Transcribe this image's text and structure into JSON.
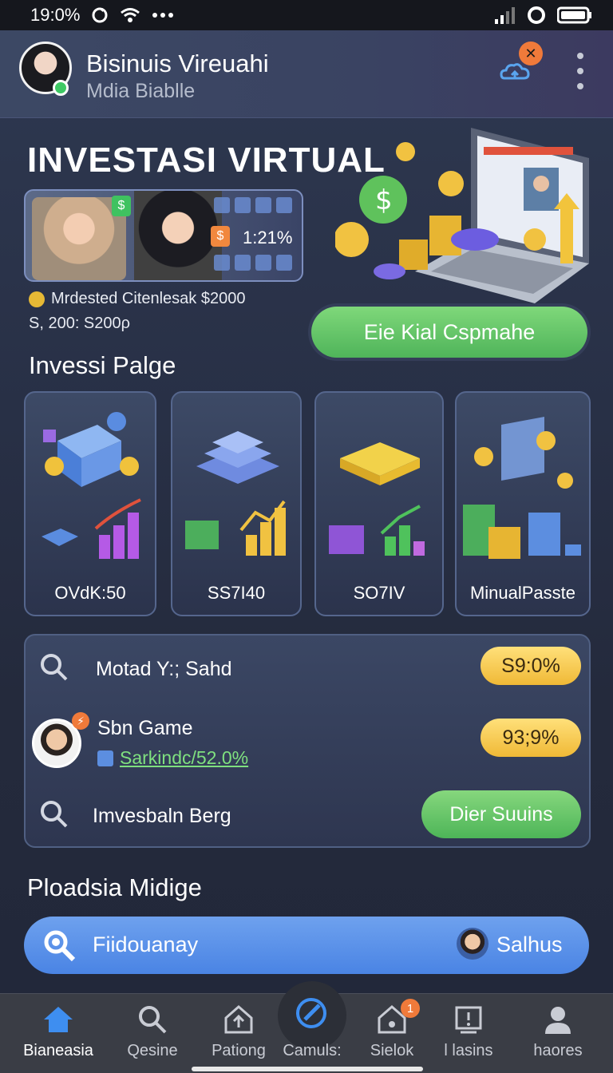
{
  "status_bar": {
    "time": "19:0%"
  },
  "header": {
    "title": "Bisinuis Vireuahi",
    "subtitle": "Mdia Biablle",
    "notification_badge": "✕"
  },
  "hero": {
    "title": "INVESTASI VIRTUAL",
    "percentage": "1:21%",
    "info_line1": "Mrdested Citenlesak $2000",
    "info_line2": "S, 200: S200ρ",
    "cta_label": "Eie Kial Cspmahe"
  },
  "portfolio": {
    "title": "Invessi Palge",
    "cards": [
      {
        "label": "OVdK:50"
      },
      {
        "label": "SS7I40"
      },
      {
        "label": "SO7IV"
      },
      {
        "label": "MinualPasste"
      }
    ]
  },
  "market_list": {
    "rows": [
      {
        "label": "Motad Y:; Sahd",
        "value": "S9:0%"
      },
      {
        "label": "Sbn Game",
        "sublabel": "Sarkindc/52.0%",
        "value": "93;9%"
      },
      {
        "label": "Imvesbaln Berg",
        "action": "Dier Suuins"
      }
    ]
  },
  "section2": {
    "title": "Ploadsia Midige"
  },
  "search": {
    "text": "Fiidouanay",
    "user": "Salhus"
  },
  "tabs": [
    {
      "label": "Bianeasia",
      "icon": "home-icon",
      "active": true
    },
    {
      "label": "Qesine",
      "icon": "search-icon"
    },
    {
      "label": "Pationg",
      "icon": "house-upload-icon"
    },
    {
      "label": "Camuls:",
      "icon": "compass-icon"
    },
    {
      "label": "Sielok",
      "icon": "house-alert-icon",
      "badge": "1"
    },
    {
      "label": "l lasins",
      "icon": "report-icon"
    },
    {
      "label": "haores",
      "icon": "profile-icon"
    }
  ],
  "colors": {
    "accent_green": "#5fbf62",
    "accent_yellow": "#f3c240",
    "accent_blue": "#4a84e4",
    "badge_orange": "#f07a3a"
  }
}
